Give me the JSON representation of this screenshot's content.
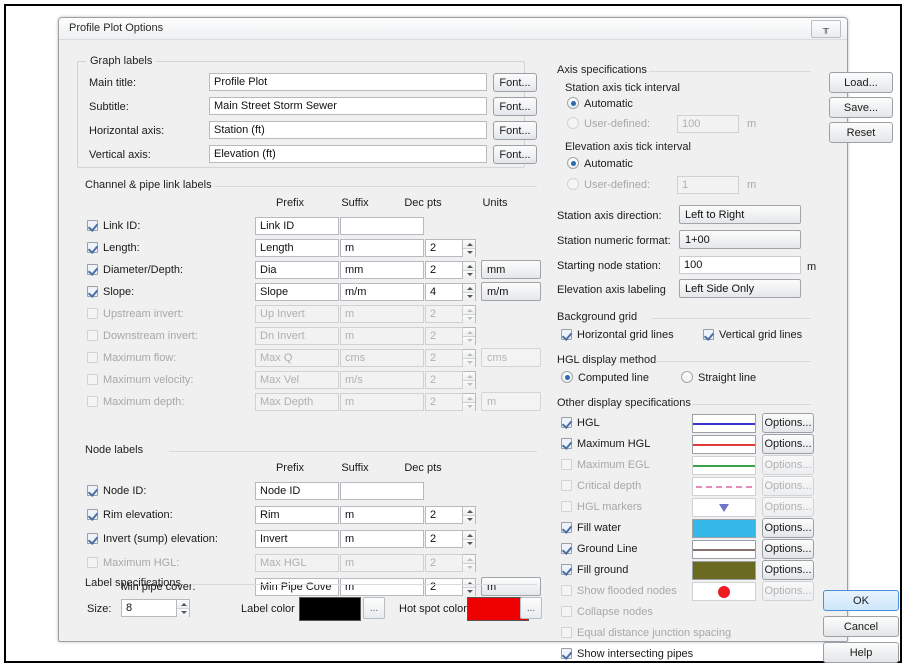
{
  "window": {
    "title": "Profile Plot Options",
    "close_icon": "close-icon"
  },
  "graph_labels": {
    "title": "Graph labels",
    "rows": [
      {
        "label": "Main title:",
        "value": "Profile Plot",
        "button": "Font..."
      },
      {
        "label": "Subtitle:",
        "value": "Main Street Storm Sewer",
        "button": "Font..."
      },
      {
        "label": "Horizontal axis:",
        "value": "Station (ft)",
        "button": "Font..."
      },
      {
        "label": "Vertical axis:",
        "value": "Elevation (ft)",
        "button": "Font..."
      }
    ]
  },
  "link_labels": {
    "title": "Channel & pipe link labels",
    "columns": [
      "Prefix",
      "Suffix",
      "Dec pts",
      "Units"
    ],
    "rows": [
      {
        "label": "Link ID:",
        "checked": true,
        "enabled": true,
        "prefix": "Link ID",
        "suffix": "",
        "dec": "",
        "has_dec": false,
        "unit": null
      },
      {
        "label": "Length:",
        "checked": true,
        "enabled": true,
        "prefix": "Length",
        "suffix": "m",
        "dec": "2",
        "has_dec": true,
        "unit": null
      },
      {
        "label": "Diameter/Depth:",
        "checked": true,
        "enabled": true,
        "prefix": "Dia",
        "suffix": "mm",
        "dec": "2",
        "has_dec": true,
        "unit": "mm"
      },
      {
        "label": "Slope:",
        "checked": true,
        "enabled": true,
        "prefix": "Slope",
        "suffix": "m/m",
        "dec": "4",
        "has_dec": true,
        "unit": "m/m"
      },
      {
        "label": "Upstream invert:",
        "checked": false,
        "enabled": false,
        "prefix": "Up Invert",
        "suffix": "m",
        "dec": "2",
        "has_dec": true,
        "unit": null
      },
      {
        "label": "Downstream invert:",
        "checked": false,
        "enabled": false,
        "prefix": "Dn Invert",
        "suffix": "m",
        "dec": "2",
        "has_dec": true,
        "unit": null
      },
      {
        "label": "Maximum flow:",
        "checked": false,
        "enabled": false,
        "prefix": "Max Q",
        "suffix": "cms",
        "dec": "2",
        "has_dec": true,
        "unit": "cms"
      },
      {
        "label": "Maximum velocity:",
        "checked": false,
        "enabled": false,
        "prefix": "Max Vel",
        "suffix": "m/s",
        "dec": "2",
        "has_dec": true,
        "unit": null
      },
      {
        "label": "Maximum depth:",
        "checked": false,
        "enabled": false,
        "prefix": "Max Depth",
        "suffix": "m",
        "dec": "2",
        "has_dec": true,
        "unit": "m"
      }
    ]
  },
  "node_labels": {
    "title": "Node labels",
    "columns": [
      "Prefix",
      "Suffix",
      "Dec pts"
    ],
    "rows": [
      {
        "label": "Node ID:",
        "checked": true,
        "enabled": true,
        "has_check": true,
        "prefix": "Node ID",
        "suffix": "",
        "dec": "",
        "has_dec": false,
        "unit": null
      },
      {
        "label": "Rim elevation:",
        "checked": true,
        "enabled": true,
        "has_check": true,
        "prefix": "Rim",
        "suffix": "m",
        "dec": "2",
        "has_dec": true,
        "unit": null
      },
      {
        "label": "Invert (sump) elevation:",
        "checked": true,
        "enabled": true,
        "has_check": true,
        "prefix": "Invert",
        "suffix": "m",
        "dec": "2",
        "has_dec": true,
        "unit": null
      },
      {
        "label": "Maximum HGL:",
        "checked": false,
        "enabled": false,
        "has_check": true,
        "prefix": "Max HGL",
        "suffix": "m",
        "dec": "2",
        "has_dec": true,
        "unit": null
      },
      {
        "label": "Min pipe cover:",
        "checked": false,
        "enabled": true,
        "has_check": false,
        "prefix": "Min Pipe Cove",
        "suffix": "m",
        "dec": "2",
        "has_dec": true,
        "unit": "m"
      }
    ]
  },
  "label_specs": {
    "title": "Label specifications",
    "size_label": "Size:",
    "size_value": "8",
    "label_color_label": "Label color",
    "label_color": "#000000",
    "hot_spot_label": "Hot spot color",
    "hot_spot_color": "#ee0000",
    "picker_glyph": "..."
  },
  "axis_specs": {
    "title": "Axis specifications",
    "station_tick_title": "Station axis tick interval",
    "station_automatic": "Automatic",
    "station_user_defined": "User-defined:",
    "station_user_value": "100",
    "station_user_unit": "m",
    "station_mode": "automatic",
    "elev_tick_title": "Elevation axis tick interval",
    "elev_automatic": "Automatic",
    "elev_user_defined": "User-defined:",
    "elev_user_value": "1",
    "elev_user_unit": "m",
    "elev_mode": "automatic",
    "direction_label": "Station axis direction:",
    "direction_value": "Left to Right",
    "numfmt_label": "Station numeric format:",
    "numfmt_value": "1+00",
    "start_station_label": "Starting node station:",
    "start_station_value": "100",
    "start_station_unit": "m",
    "elev_labeling_label": "Elevation axis labeling",
    "elev_labeling_value": "Left Side Only"
  },
  "background_grid": {
    "title": "Background grid",
    "horizontal": "Horizontal grid lines",
    "horizontal_checked": true,
    "vertical": "Vertical grid lines",
    "vertical_checked": true
  },
  "hgl_method": {
    "title": "HGL display method",
    "computed": "Computed line",
    "straight": "Straight line",
    "selected": "computed"
  },
  "other_display": {
    "title": "Other display specifications",
    "options_label": "Options...",
    "rows": [
      {
        "label": "HGL",
        "checked": true,
        "enabled": true,
        "swatch": "line",
        "color": "#3a34c8",
        "has_swatch": true
      },
      {
        "label": "Maximum HGL",
        "checked": true,
        "enabled": true,
        "swatch": "line",
        "color": "#e03a3a",
        "has_swatch": true
      },
      {
        "label": "Maximum EGL",
        "checked": false,
        "enabled": false,
        "swatch": "line",
        "color": "#3aa34a",
        "has_swatch": true
      },
      {
        "label": "Critical depth",
        "checked": false,
        "enabled": false,
        "swatch": "dotted",
        "color": "#e78bbd",
        "has_swatch": true
      },
      {
        "label": "HGL markers",
        "checked": false,
        "enabled": false,
        "swatch": "triangle",
        "color": "#6b74c6",
        "has_swatch": true
      },
      {
        "label": "Fill water",
        "checked": true,
        "enabled": true,
        "swatch": "fill",
        "color": "#35b8e8",
        "has_swatch": true
      },
      {
        "label": "Ground Line",
        "checked": true,
        "enabled": true,
        "swatch": "line",
        "color": "#8a7070",
        "has_swatch": true
      },
      {
        "label": "Fill ground",
        "checked": true,
        "enabled": true,
        "swatch": "fill",
        "color": "#6b6a22",
        "has_swatch": true
      },
      {
        "label": "Show flooded nodes",
        "checked": false,
        "enabled": false,
        "swatch": "dot",
        "color": "#ed1c24",
        "has_swatch": true
      },
      {
        "label": "Collapse nodes",
        "checked": false,
        "enabled": false,
        "swatch": "none",
        "color": "",
        "has_swatch": false
      },
      {
        "label": "Equal distance junction spacing",
        "checked": false,
        "enabled": false,
        "swatch": "none",
        "color": "",
        "has_swatch": false
      },
      {
        "label": "Show intersecting pipes",
        "checked": true,
        "enabled": true,
        "swatch": "none",
        "color": "",
        "has_swatch": false
      }
    ]
  },
  "side_buttons": {
    "load": "Load...",
    "save": "Save...",
    "reset": "Reset"
  },
  "action_buttons": {
    "ok": "OK",
    "cancel": "Cancel",
    "help": "Help"
  }
}
